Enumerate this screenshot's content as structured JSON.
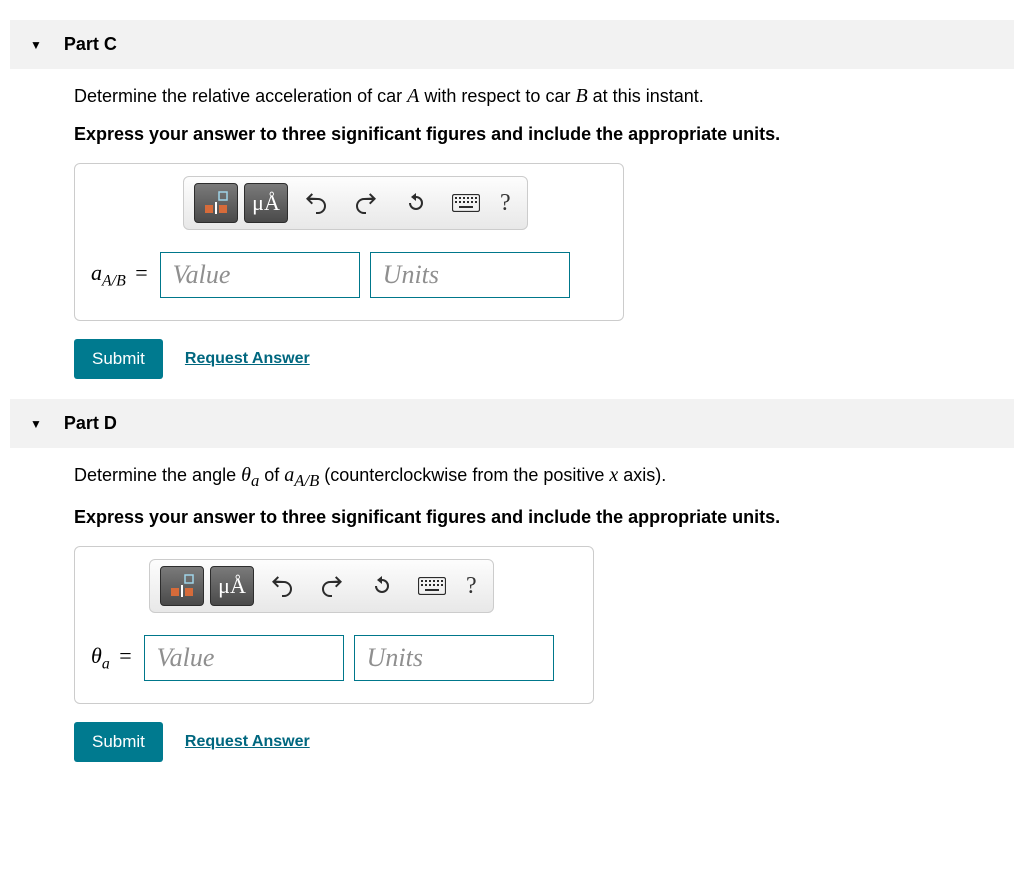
{
  "partC": {
    "label": "Part C",
    "prompt_pre": "Determine the relative acceleration of car ",
    "prompt_mid": " with respect to car ",
    "prompt_post": " at this instant.",
    "carA": "A",
    "carB": "B",
    "instruction": "Express your answer to three significant figures and include the appropriate units.",
    "var_html": "a<sub>A/B</sub>",
    "var_a": "a",
    "var_sub": "A/B",
    "value_placeholder": "Value",
    "units_placeholder": "Units",
    "submit": "Submit",
    "request": "Request Answer",
    "toolbar": {
      "mu_label": "μÅ",
      "help": "?"
    }
  },
  "partD": {
    "label": "Part D",
    "prompt_pre": "Determine the angle ",
    "theta": "θ",
    "theta_sub": "a",
    "prompt_of": " of ",
    "a_var": "a",
    "a_sub": "A/B",
    "prompt_post_pre": " (counterclockwise from the positive ",
    "x_var": "x",
    "prompt_post_post": " axis).",
    "instruction": "Express your answer to three significant figures and include the appropriate units.",
    "value_placeholder": "Value",
    "units_placeholder": "Units",
    "submit": "Submit",
    "request": "Request Answer",
    "toolbar": {
      "mu_label": "μÅ",
      "help": "?"
    }
  }
}
